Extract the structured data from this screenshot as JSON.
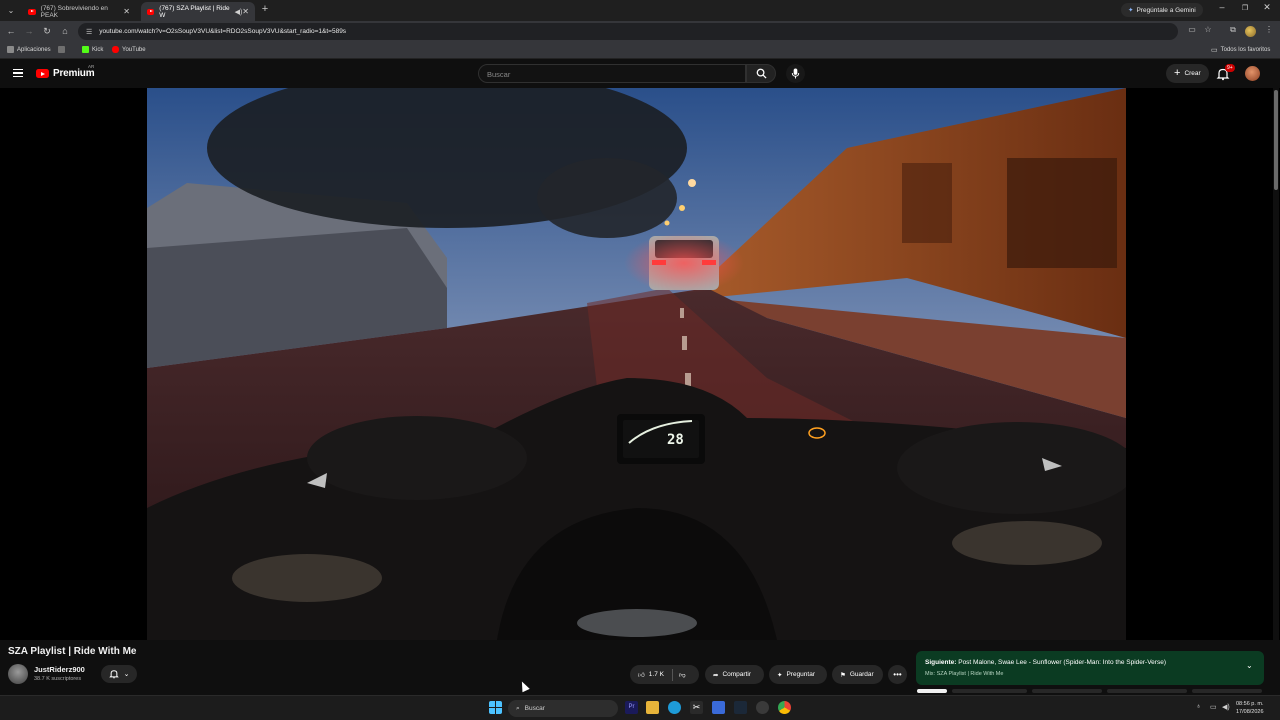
{
  "browser": {
    "tabs": [
      {
        "title": "(767) Sobreviviendo en PEAK"
      },
      {
        "title": "(767) SZA Playlist | Ride W"
      }
    ],
    "gemini_label": "Pregúntale a Gemini",
    "url": "youtube.com/watch?v=O2sSoupV3VU&list=RDO2sSoupV3VU&start_radio=1&t=589s",
    "bookmarks": [
      "Aplicaciones",
      "Kick",
      "YouTube"
    ],
    "bookmarks_all": "Todos los favoritos"
  },
  "youtube": {
    "logo_text": "Premium",
    "logo_country": "AR",
    "search_placeholder": "Buscar",
    "create_label": "Crear",
    "notif_count": "9+"
  },
  "video": {
    "title": "SZA Playlist | Ride With Me",
    "channel": "JustRiderz900",
    "subscribers": "38.7 K suscriptores",
    "likes": "1.7 K",
    "share_label": "Compartir",
    "ask_label": "Preguntar",
    "save_label": "Guardar",
    "dash_speed": "28"
  },
  "up_next": {
    "label": "Siguiente:",
    "title": "Post Malone, Swae Lee - Sunflower (Spider-Man: Into the Spider-Verse)",
    "subtitle": "Mix: SZA Playlist | Ride With Me"
  },
  "taskbar": {
    "search_label": "Buscar",
    "time": "08:56 p. m.",
    "date": "17/08/2026"
  },
  "colors": {
    "youtube_red": "#ff0000",
    "up_next_bg": "#0b3b22",
    "page_bg": "#0f0f0f"
  }
}
